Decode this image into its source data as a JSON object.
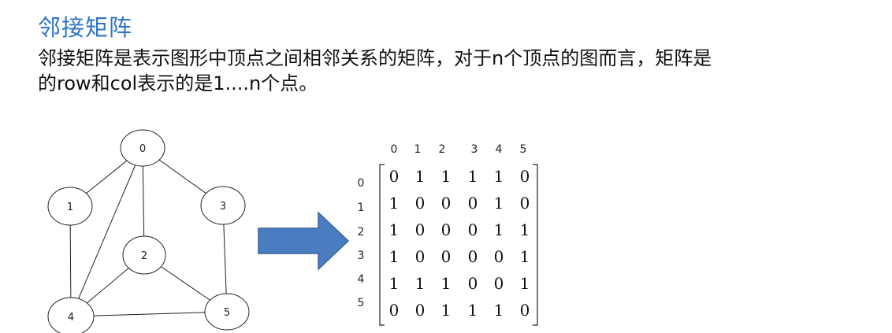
{
  "title": "邻接矩阵",
  "description_line1": "邻接矩阵是表示图形中顶点之间相邻关系的矩阵，对于n个顶点的图而言，矩阵是",
  "description_line2": "的row和col表示的是1....n个点。",
  "graph": {
    "nodes": [
      {
        "id": "0",
        "label": "0"
      },
      {
        "id": "1",
        "label": "1"
      },
      {
        "id": "2",
        "label": "2"
      },
      {
        "id": "3",
        "label": "3"
      },
      {
        "id": "4",
        "label": "4"
      },
      {
        "id": "5",
        "label": "5"
      }
    ],
    "edges": [
      [
        "0",
        "1"
      ],
      [
        "0",
        "2"
      ],
      [
        "0",
        "3"
      ],
      [
        "0",
        "4"
      ],
      [
        "1",
        "4"
      ],
      [
        "2",
        "4"
      ],
      [
        "2",
        "5"
      ],
      [
        "3",
        "5"
      ],
      [
        "4",
        "5"
      ]
    ]
  },
  "arrow_color": "#4a7cc0",
  "matrix": {
    "col_headers": [
      "0",
      "1",
      "2",
      "3",
      "4",
      "5"
    ],
    "row_headers": [
      "0",
      "1",
      "2",
      "3",
      "4",
      "5"
    ],
    "rows": [
      [
        "0",
        "1",
        "1",
        "1",
        "1",
        "0"
      ],
      [
        "1",
        "0",
        "0",
        "0",
        "1",
        "0"
      ],
      [
        "1",
        "0",
        "0",
        "0",
        "1",
        "1"
      ],
      [
        "1",
        "0",
        "0",
        "0",
        "0",
        "1"
      ],
      [
        "1",
        "1",
        "1",
        "0",
        "0",
        "1"
      ],
      [
        "0",
        "0",
        "1",
        "1",
        "1",
        "0"
      ]
    ]
  }
}
